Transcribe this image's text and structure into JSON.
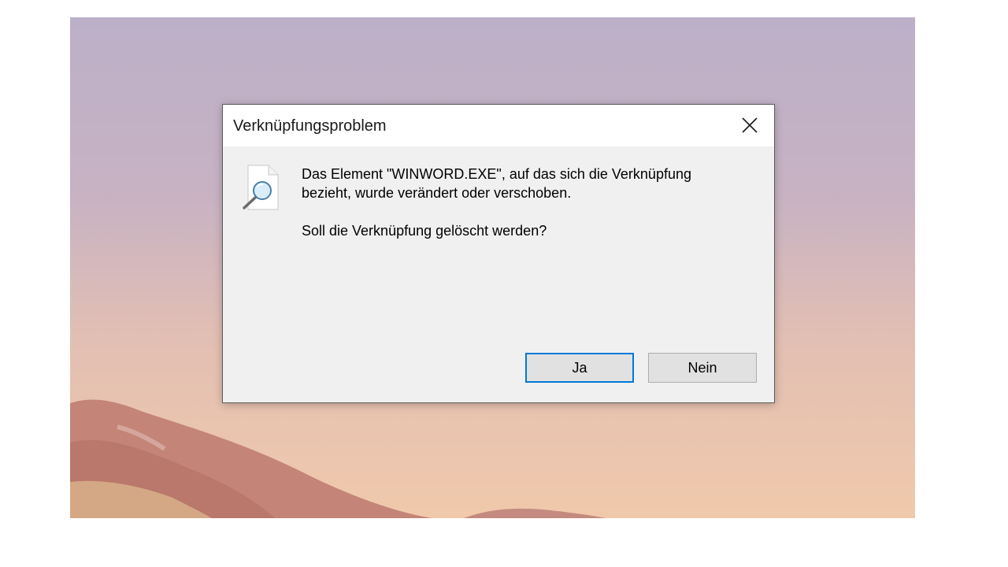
{
  "dialog": {
    "title": "Verknüpfungsproblem",
    "message_line1": "Das Element \"WINWORD.EXE\", auf das sich die Verknüpfung",
    "message_line2": "bezieht, wurde verändert oder verschoben.",
    "question": "Soll die Verknüpfung gelöscht werden?",
    "icon": "file-search-icon",
    "close_icon": "close-icon"
  },
  "buttons": {
    "yes_label": "Ja",
    "no_label": "Nein",
    "default": "yes"
  },
  "colors": {
    "focus_border": "#0078d7",
    "dialog_body": "#f0f0f0",
    "titlebar": "#ffffff"
  }
}
